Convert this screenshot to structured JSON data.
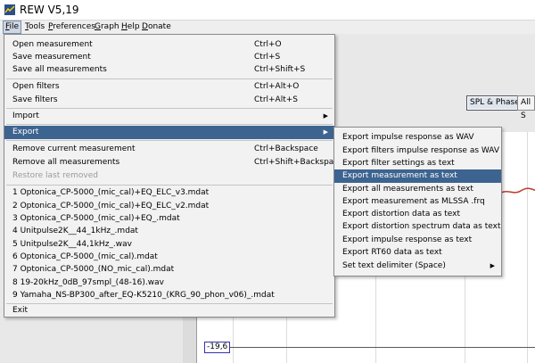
{
  "window": {
    "title": "REW V5,19"
  },
  "menubar": [
    {
      "label": "File",
      "mnemonic": "F",
      "active": true
    },
    {
      "label": "Tools"
    },
    {
      "label": "Preferences"
    },
    {
      "label": "Graph"
    },
    {
      "label": "Help"
    },
    {
      "label": "Donate"
    }
  ],
  "background": {
    "view_toggle": {
      "spl_phase": "SPL & Phase",
      "all": "All S"
    },
    "y_value": "-19,6"
  },
  "file_menu": {
    "items": [
      {
        "label": "Open measurement",
        "accel": "Ctrl+O"
      },
      {
        "label": "Save measurement",
        "accel": "Ctrl+S"
      },
      {
        "label": "Save all measurements",
        "accel": "Ctrl+Shift+S"
      },
      {
        "label": "Open filters",
        "accel": "Ctrl+Alt+O"
      },
      {
        "label": "Save filters",
        "accel": "Ctrl+Alt+S"
      },
      {
        "label": "Import",
        "accel": ""
      },
      {
        "label": "Export",
        "accel": ""
      },
      {
        "label": "Remove current measurement",
        "accel": "Ctrl+Backspace"
      },
      {
        "label": "Remove all measurements",
        "accel": "Ctrl+Shift+Backspace"
      },
      {
        "label": "Restore last removed",
        "accel": ""
      },
      {
        "label": "1 Optonica_CP-5000_(mic_cal)+EQ_ELC_v3.mdat"
      },
      {
        "label": "2 Optonica_CP-5000_(mic_cal)+EQ_ELC_v2.mdat"
      },
      {
        "label": "3 Optonica_CP-5000_(mic_cal)+EQ_.mdat"
      },
      {
        "label": "4 Unitpulse2K__44_1kHz_.mdat"
      },
      {
        "label": "5 Unitpulse2K__44,1kHz_.wav"
      },
      {
        "label": "6 Optonica_CP-5000_(mic_cal).mdat"
      },
      {
        "label": "7 Optonica_CP-5000_(NO_mic_cal).mdat"
      },
      {
        "label": "8 19-20kHz_0dB_97smpl_(48-16).wav"
      },
      {
        "label": "9 Yamaha_NS-BP300_after_EQ-K5210_(KRG_90_phon_v06)_.mdat"
      },
      {
        "label": "Exit"
      }
    ]
  },
  "export_menu": {
    "items": [
      {
        "label": "Export impulse response as WAV"
      },
      {
        "label": "Export filters impulse response as WAV"
      },
      {
        "label": "Export filter settings as text"
      },
      {
        "label": "Export measurement as text"
      },
      {
        "label": "Export all measurements as text"
      },
      {
        "label": "Export measurement as MLSSA .frq"
      },
      {
        "label": "Export distortion data as text"
      },
      {
        "label": "Export distortion spectrum data as text"
      },
      {
        "label": "Export impulse response as text"
      },
      {
        "label": "Export RT60 data as text"
      },
      {
        "label": "Set text delimiter (Space)"
      }
    ]
  },
  "colors": {
    "selection": "#3d6490",
    "trace": "#c0392b"
  }
}
